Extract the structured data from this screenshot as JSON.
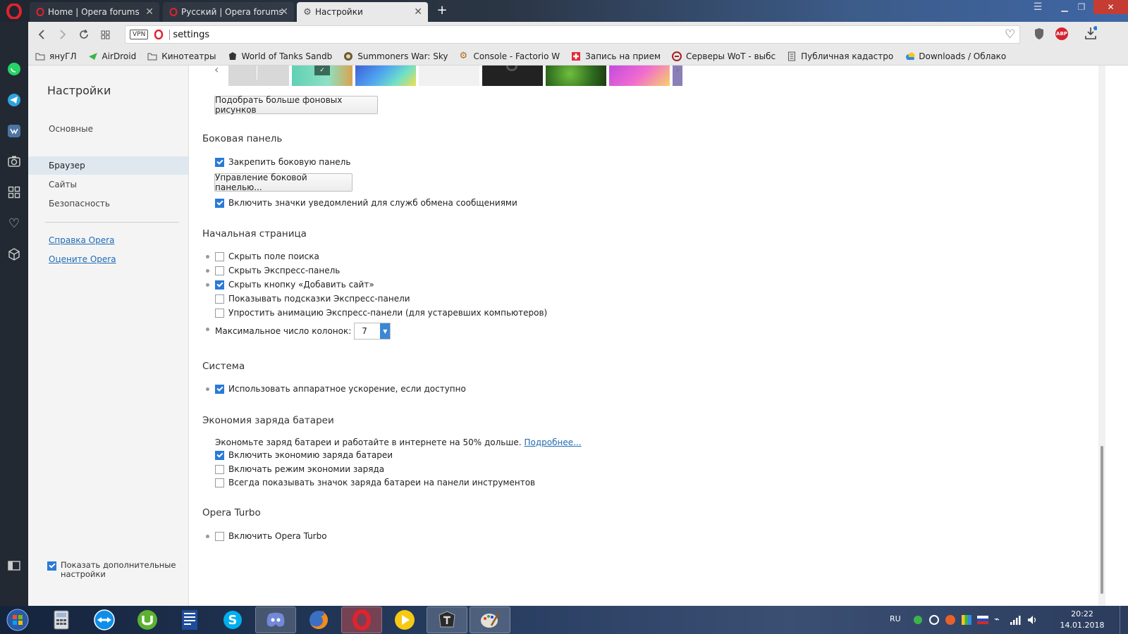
{
  "tabs": [
    {
      "label": "Home | Opera forums",
      "active": false
    },
    {
      "label": "Русский | Opera forums",
      "active": false
    },
    {
      "label": "Настройки",
      "active": true
    }
  ],
  "address": {
    "url": "settings",
    "vpn_label": "VPN"
  },
  "extensions": {
    "adblock_label": "ABP"
  },
  "bookmarks": [
    {
      "label": "януГЛ",
      "icon": "folder-icon"
    },
    {
      "label": "AirDroid",
      "icon": "airdroid-icon"
    },
    {
      "label": "Кинотеатры",
      "icon": "folder-icon"
    },
    {
      "label": "World of Tanks Sandb",
      "icon": "wot-icon"
    },
    {
      "label": "Summoners War: Sky",
      "icon": "game-icon"
    },
    {
      "label": "Console - Factorio W",
      "icon": "gear-icon"
    },
    {
      "label": "Запись на прием",
      "icon": "medical-icon"
    },
    {
      "label": "Серверы WoT - выбс",
      "icon": "wot-icon"
    },
    {
      "label": "Публичная кадастро",
      "icon": "document-icon"
    },
    {
      "label": "Downloads / Облако",
      "icon": "cloud-icon"
    }
  ],
  "settings_nav": {
    "title": "Настройки",
    "items": [
      {
        "label": "Основные",
        "selected": false
      },
      {
        "label": "Браузер",
        "selected": true
      },
      {
        "label": "Сайты",
        "selected": false
      },
      {
        "label": "Безопасность",
        "selected": false
      }
    ],
    "links": [
      "Справка Opera",
      "Оцените Opera"
    ],
    "show_advanced": {
      "label_line1": "Показать дополнительные",
      "label_line2": "настройки",
      "checked": true
    }
  },
  "content": {
    "more_wallpapers_button": "Подобрать больше фоновых рисунков",
    "sidebar_section": {
      "heading": "Боковая панель",
      "pin_sidebar": {
        "label": "Закрепить боковую панель",
        "checked": true
      },
      "manage_button": "Управление боковой панелью...",
      "notifications": {
        "label": "Включить значки уведомлений для служб обмена сообщениями",
        "checked": true
      }
    },
    "start_page": {
      "heading": "Начальная страница",
      "options": [
        {
          "label": "Скрыть поле поиска",
          "checked": false,
          "bullet": true
        },
        {
          "label": "Скрыть Экспресс-панель",
          "checked": false,
          "bullet": true
        },
        {
          "label": "Скрыть кнопку «Добавить сайт»",
          "checked": true,
          "bullet": true
        },
        {
          "label": "Показывать подсказки Экспресс-панели",
          "checked": false,
          "bullet": false
        },
        {
          "label": "Упростить анимацию Экспресс-панели (для устаревших компьютеров)",
          "checked": false,
          "bullet": false
        }
      ],
      "max_columns_label": "Максимальное число колонок:",
      "max_columns_value": "7"
    },
    "system": {
      "heading": "Система",
      "hw_accel": {
        "label": "Использовать аппаратное ускорение, если доступно",
        "checked": true
      }
    },
    "battery": {
      "heading": "Экономия заряда батареи",
      "description": "Экономьте заряд батареи и работайте в интернете на 50% дольше.",
      "more_link": "Подробнее...",
      "options": [
        {
          "label": "Включить экономию заряда батареи",
          "checked": true
        },
        {
          "label": "Включать режим экономии заряда",
          "checked": false
        },
        {
          "label": "Всегда показывать значок заряда батареи на панели инструментов",
          "checked": false
        }
      ]
    },
    "turbo": {
      "heading": "Opera Turbo",
      "enable": {
        "label": "Включить Opera Turbo",
        "checked": false
      }
    }
  },
  "taskbar": {
    "language": "RU",
    "time": "20:22",
    "date": "14.01.2018"
  },
  "colors": {
    "accent": "#2a7ad8",
    "opera_red": "#e0232e",
    "link": "#1f6bb3"
  }
}
